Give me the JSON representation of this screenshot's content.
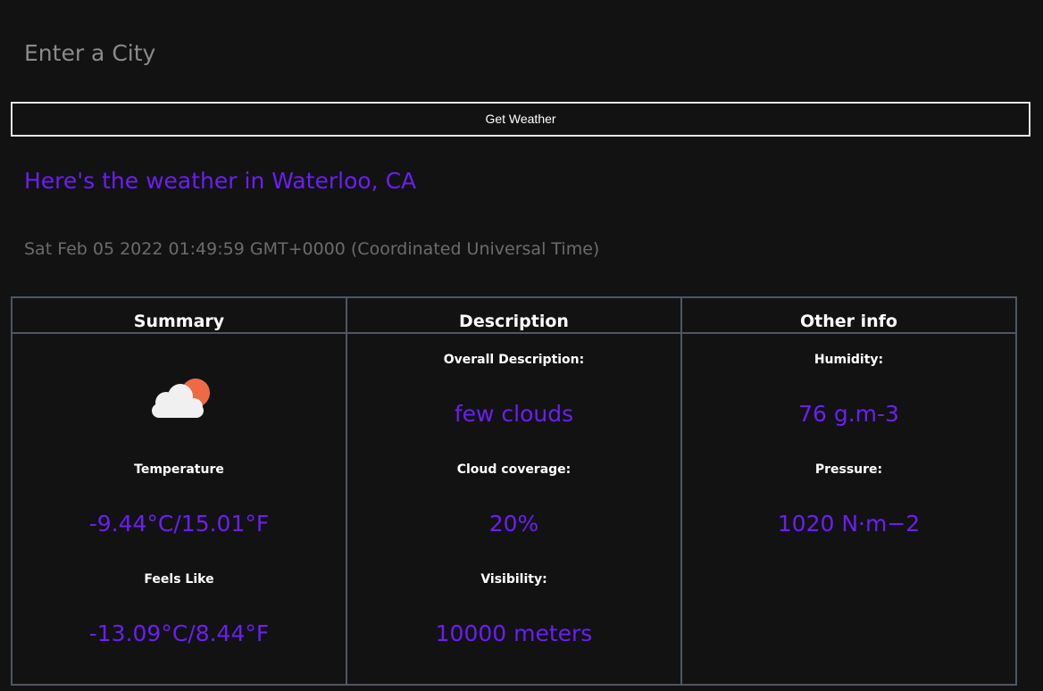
{
  "search": {
    "placeholder": "Enter a City",
    "button_label": "Get Weather"
  },
  "heading": "Here's the weather in Waterloo, CA",
  "datetime": "Sat Feb 05 2022 01:49:59 GMT+0000 (Coordinated Universal Time)",
  "colors": {
    "background": "#121213",
    "accent": "#6b1ff0",
    "border": "#4f5663",
    "sun": "#ee6a45",
    "cloud": "#f0f0f0"
  },
  "summary": {
    "title": "Summary",
    "icon": "few-clouds-icon",
    "temperature_label": "Temperature",
    "temperature_value": "-9.44°C/15.01°F",
    "feels_like_label": "Feels Like",
    "feels_like_value": "-13.09°C/8.44°F"
  },
  "description": {
    "title": "Description",
    "overall_label": "Overall Description:",
    "overall_value": "few clouds",
    "cloud_label": "Cloud coverage:",
    "cloud_value": "20%",
    "visibility_label": "Visibility:",
    "visibility_value": "10000 meters"
  },
  "other": {
    "title": "Other info",
    "humidity_label": "Humidity:",
    "humidity_value": "76 g.m-3",
    "pressure_label": "Pressure:",
    "pressure_value": "1020 N·m−2"
  }
}
